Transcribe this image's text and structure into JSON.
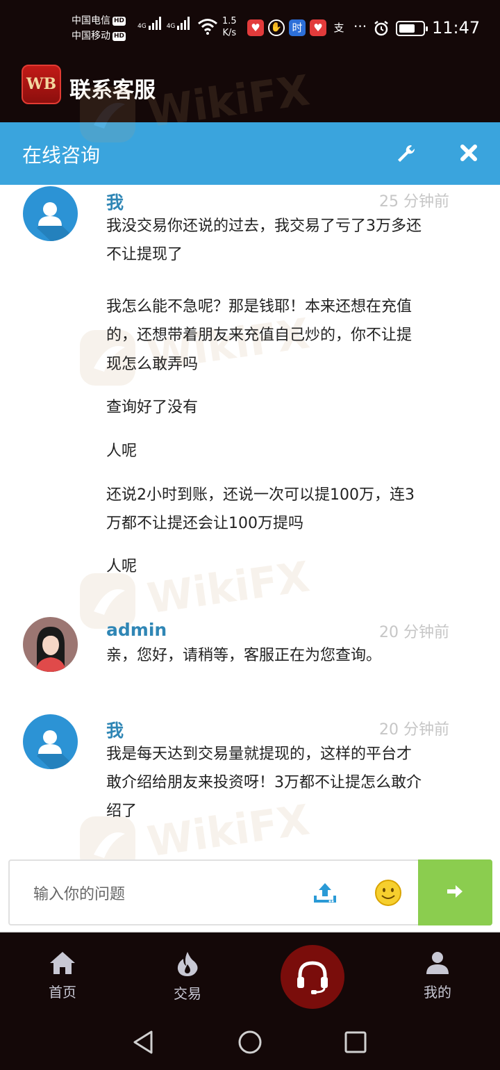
{
  "status_bar": {
    "carrier_1": "中国电信",
    "carrier_2": "中国移动",
    "hd_badge": "HD",
    "network_type": "4G",
    "net_speed_value": "1.5",
    "net_speed_unit": "K/s",
    "time": "11:47",
    "battery_level": 0.7,
    "notification_icons": [
      "health-app-icon",
      "hand-icon",
      "时",
      "health-app-icon",
      "支"
    ],
    "more": "···"
  },
  "header": {
    "logo_text": "WB",
    "title": "联系客服"
  },
  "consult_bar": {
    "title": "在线咨询",
    "wrench_icon": "wrench-icon",
    "close_icon": "close-icon"
  },
  "messages": [
    {
      "sender": "我",
      "time": "25 分钟前",
      "avatar": "user-avatar",
      "lines": [
        "我没交易你还说的过去，我交易了亏了3万多还",
        "不让提现了",
        "",
        "我怎么能不急呢？那是钱耶！本来还想在充值",
        "的，还想带着朋友来充值自己炒的，你不让提",
        "现怎么敢弄吗",
        "查询好了没有",
        "人呢",
        "还说2小时到账，还说一次可以提100万，连3",
        "万都不让提还会让100万提吗",
        "人呢"
      ]
    },
    {
      "sender": "admin",
      "time": "20 分钟前",
      "avatar": "admin-avatar",
      "lines": [
        "亲，您好，请稍等，客服正在为您查询。"
      ]
    },
    {
      "sender": "我",
      "time": "20 分钟前",
      "avatar": "user-avatar",
      "lines": [
        "我是每天达到交易量就提现的，这样的平台才",
        "敢介绍给朋友来投资呀！3万都不让提怎么敢介",
        "绍了"
      ]
    }
  ],
  "input": {
    "placeholder": "输入你的问题",
    "upload_icon": "upload-icon",
    "emoji_icon": "emoji-icon",
    "send_icon": "arrow-right-icon"
  },
  "bottom_nav": {
    "items": [
      {
        "label": "首页",
        "icon": "home-icon"
      },
      {
        "label": "交易",
        "icon": "flame-icon"
      },
      {
        "label": "",
        "icon": "headset-icon"
      },
      {
        "label": "我的",
        "icon": "person-icon"
      }
    ]
  },
  "watermark": "WikiFX",
  "colors": {
    "dark_bg": "#140808",
    "consult_blue": "#3aa4dd",
    "sender_blue": "#2f86b5",
    "send_green": "#8bcd4f",
    "center_red": "#7a0d0b"
  }
}
